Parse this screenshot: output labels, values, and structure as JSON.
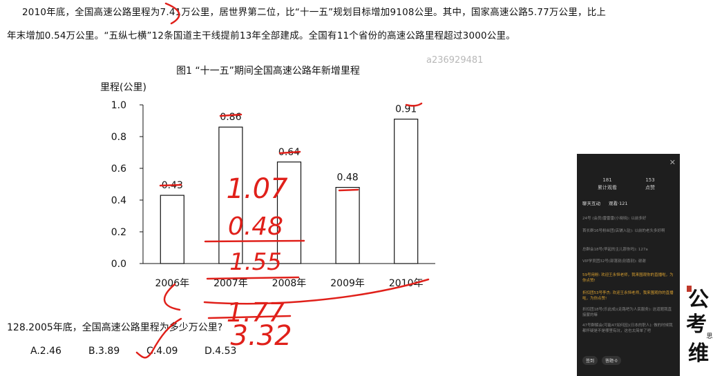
{
  "text": {
    "para1": "2010年底，全国高速公路里程为7.41万公里，居世界第二位，比“十一五”规划目标增加9108公里。其中，国家高速公路5.77万公里，比上",
    "para2": "年末增加0.54万公里。“五纵七横”12条国道主干线提前13年全部建成。全国有11个省份的高速公路里程超过3000公里。",
    "watermark": "a236929481",
    "question": "128.2005年底，全国高速公路里程为多少万公里?",
    "options": [
      "A.2.46",
      "B.3.89",
      "C.4.09",
      "D.4.53"
    ]
  },
  "chart_data": {
    "type": "bar",
    "title": "图1 “十一五”期间全国高速公路年新增里程",
    "ylabel": "里程(公里)",
    "xlabel": "",
    "categories": [
      "2006年",
      "2007年",
      "2008年",
      "2009年",
      "2010年"
    ],
    "values": [
      0.43,
      0.86,
      0.64,
      0.48,
      0.91
    ],
    "value_labels": [
      "0.43",
      "0.86",
      "0.64",
      "0.48",
      "0.91"
    ],
    "ylim": [
      0,
      1.0
    ],
    "yticks": [
      "0.0",
      "0.2",
      "0.4",
      "0.6",
      "0.8",
      "1.0"
    ],
    "grid": false
  },
  "annotations": {
    "handwritten": [
      "1.07",
      "0.48",
      "1.55",
      "1.77",
      "3.32"
    ],
    "color": "#e0201a"
  },
  "side_panel": {
    "stats": [
      {
        "value": "181",
        "label": "累计观看"
      },
      {
        "value": "153",
        "label": "点赞"
      }
    ],
    "tabs": [
      "聊天互动",
      "观看·121"
    ],
    "messages": [
      {
        "text": "24号 (会员)雷雷雷(小晓晓): 以前多好",
        "highlight": false
      },
      {
        "text": "首长群16号粉丝团(店铺入驻): 以前的老头多好啊",
        "highlight": false
      },
      {
        "text": "总群会18号(早起的主儿那你吗): 127a",
        "highlight": false
      },
      {
        "text": "VIP学员团32号(部落别(别喜别): 谢谢",
        "highlight": false
      },
      {
        "text": "59号用粉: 欢迎王永恒老师，我来围观你的直播啦，为你点赞!",
        "highlight": true
      },
      {
        "text": "折扣团53号李杰: 欢迎王永恒老师，我来围观你的直播啦，为你点赞!",
        "highlight": true
      },
      {
        "text": "折扣团18号(乐此成)(走路吧为人民服务): 这道题我直接蒙的嘛",
        "highlight": false
      },
      {
        "text": "47号群解会(可能47如何因)(日本的职人): 做的时候我都怀疑是不是哪里有坑，这也太简单了吧",
        "highlight": false
      }
    ],
    "buttons": [
      "签到",
      "答题·0"
    ]
  },
  "logo_text": "公考思维"
}
